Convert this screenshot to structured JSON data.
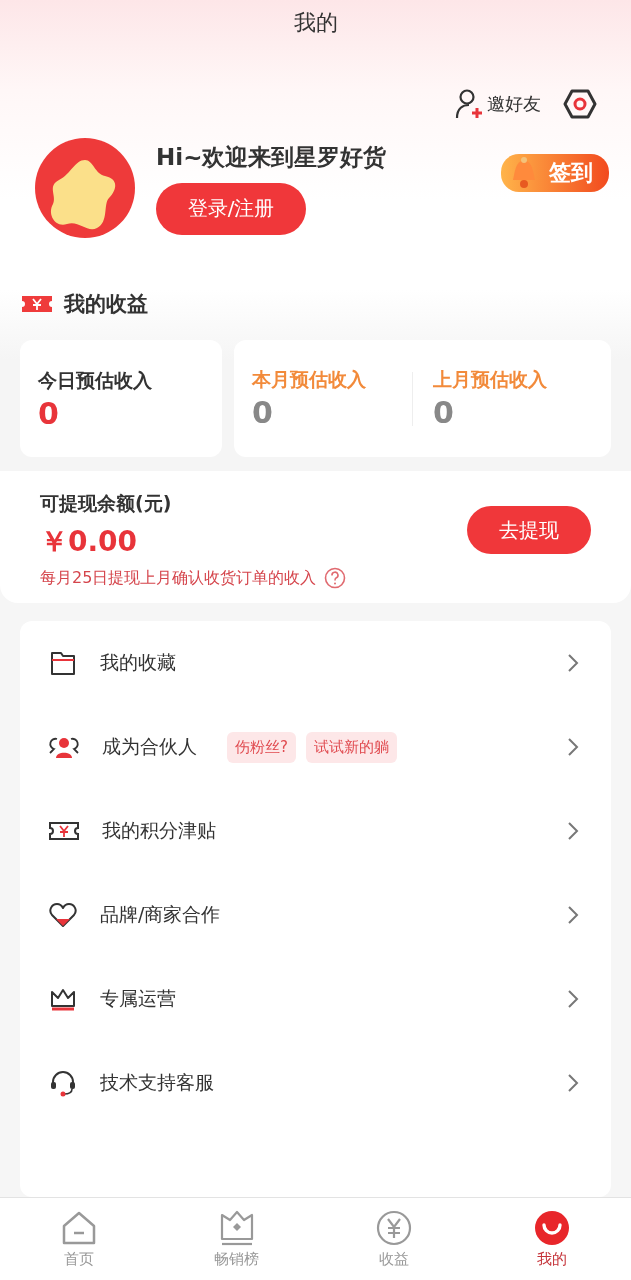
{
  "header": {
    "title": "我的"
  },
  "top_actions": {
    "invite": "邀好友"
  },
  "profile": {
    "greeting": "Hi~欢迎来到星罗好货",
    "login_button": "登录/注册",
    "checkin_button": "签到"
  },
  "earnings": {
    "title": "我的收益",
    "today": {
      "label": "今日预估收入",
      "value": "0"
    },
    "months": [
      {
        "label": "本月预估收入",
        "value": "0"
      },
      {
        "label": "上月预估收入",
        "value": "0"
      }
    ]
  },
  "withdraw": {
    "label": "可提现余额(元)",
    "amount": "￥0.00",
    "button": "去提现",
    "note": "每月25日提现上月确认收货订单的收入"
  },
  "menu": [
    {
      "kind": "folder",
      "label": "我的收藏"
    },
    {
      "kind": "people",
      "label": "成为合伙人",
      "tags": [
        "伤粉丝?",
        "试试新的躺"
      ]
    },
    {
      "kind": "ticket",
      "label": "我的积分津贴"
    },
    {
      "kind": "heart",
      "label": "品牌/商家合作"
    },
    {
      "kind": "crown",
      "label": "专属运营"
    },
    {
      "kind": "headset",
      "label": "技术支持客服"
    }
  ],
  "tabbar": [
    {
      "kind": "home",
      "label": "首页",
      "selected": false
    },
    {
      "kind": "chart",
      "label": "畅销榜",
      "selected": false
    },
    {
      "kind": "yen",
      "label": "收益",
      "selected": false
    },
    {
      "kind": "smile",
      "label": "我的",
      "selected": true
    }
  ]
}
